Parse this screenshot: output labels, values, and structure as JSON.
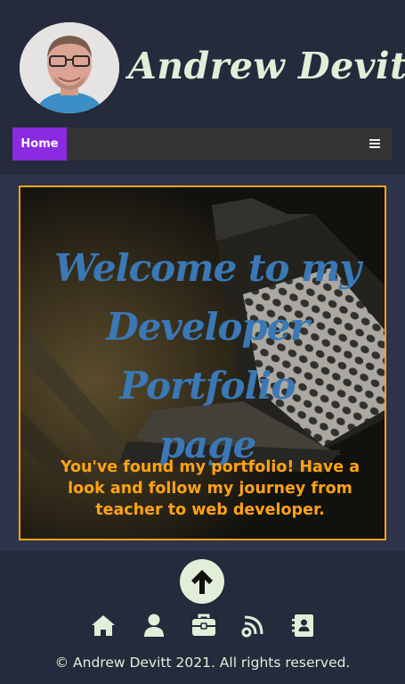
{
  "header": {
    "site_title": "Andrew Devitt",
    "avatar_icon": "profile-photo"
  },
  "nav": {
    "home_label": "Home",
    "menu_icon": "bars-icon"
  },
  "hero": {
    "title_line1": "Welcome to my",
    "title_line2": "Developer Portfolio",
    "title_line3": "page",
    "subtitle_line1": "You've found my portfolio! Have a",
    "subtitle_line2": "look and follow my journey from",
    "subtitle_line3": "teacher to web developer."
  },
  "footer": {
    "icons": [
      "arrow-up-icon",
      "home-icon",
      "user-icon",
      "briefcase-icon",
      "blog-icon",
      "contact-book-icon"
    ],
    "copyright": "© Andrew Devitt 2021. All rights reserved."
  },
  "colors": {
    "background": "#252a3c",
    "band": "#2e3449",
    "accent_purple": "#8a2be2",
    "accent_orange": "#ffa313",
    "hero_title_blue": "#3a78b6",
    "light_text": "#e3eed9"
  }
}
